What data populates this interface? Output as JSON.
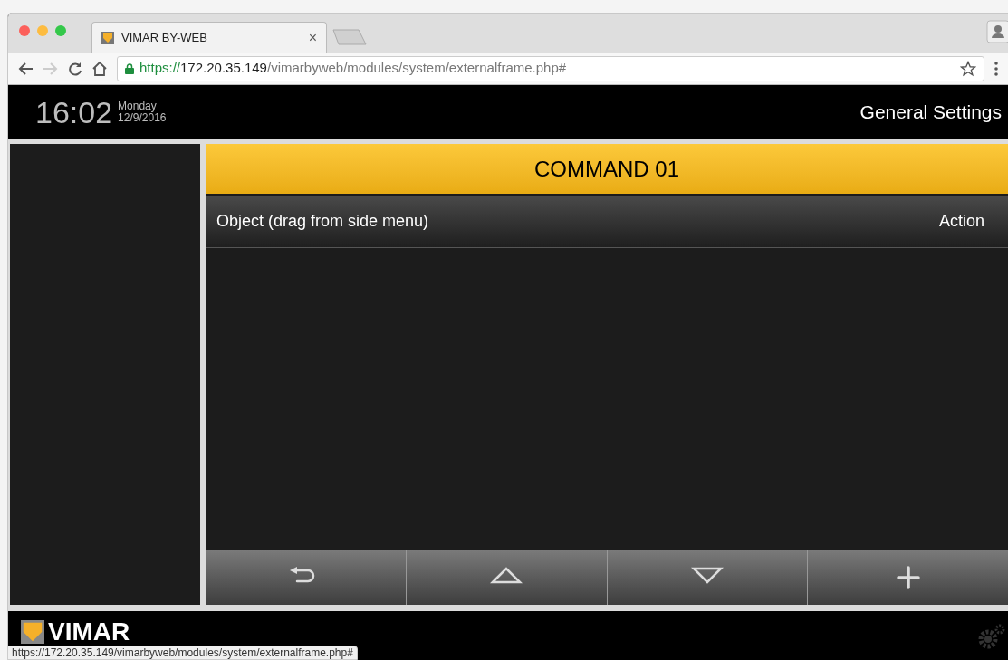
{
  "browser": {
    "tab_title": "VIMAR BY-WEB",
    "tab_close": "×",
    "url": {
      "scheme": "https://",
      "host": "172.20.35.149",
      "path": "/vimarbyweb/modules/system/externalframe.php#"
    }
  },
  "header": {
    "time": "16:02",
    "day": "Monday",
    "date": "12/9/2016",
    "title": "General Settings"
  },
  "panel": {
    "title": "COMMAND 01",
    "columns": [
      "Object (drag from side menu)",
      "Action"
    ]
  },
  "toolbar": [
    {
      "kind": "back"
    },
    {
      "kind": "up"
    },
    {
      "kind": "down"
    },
    {
      "kind": "add"
    }
  ],
  "footer": {
    "logo": "VIMAR"
  },
  "status_bar": "https://172.20.35.149/vimarbyweb/modules/system/externalframe.php#"
}
